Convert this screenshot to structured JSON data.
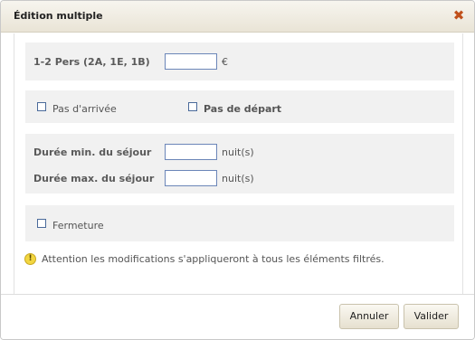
{
  "dialog": {
    "title": "Édition multiple",
    "close_icon": "close-icon"
  },
  "price": {
    "label": "1-2 Pers (2A, 1E, 1B)",
    "value": "",
    "unit": "€"
  },
  "options": {
    "no_arrival_label": "Pas d'arrivée",
    "no_departure_label": "Pas de départ"
  },
  "stay": {
    "min_label": "Durée min. du séjour",
    "min_value": "",
    "max_label": "Durée max. du séjour",
    "max_value": "",
    "unit": "nuit(s)"
  },
  "closure": {
    "label": "Fermeture"
  },
  "warning": {
    "icon": "warning-icon",
    "text": "Attention les modifications s'appliqueront à tous les éléments filtrés."
  },
  "footer": {
    "cancel_label": "Annuler",
    "validate_label": "Valider"
  }
}
